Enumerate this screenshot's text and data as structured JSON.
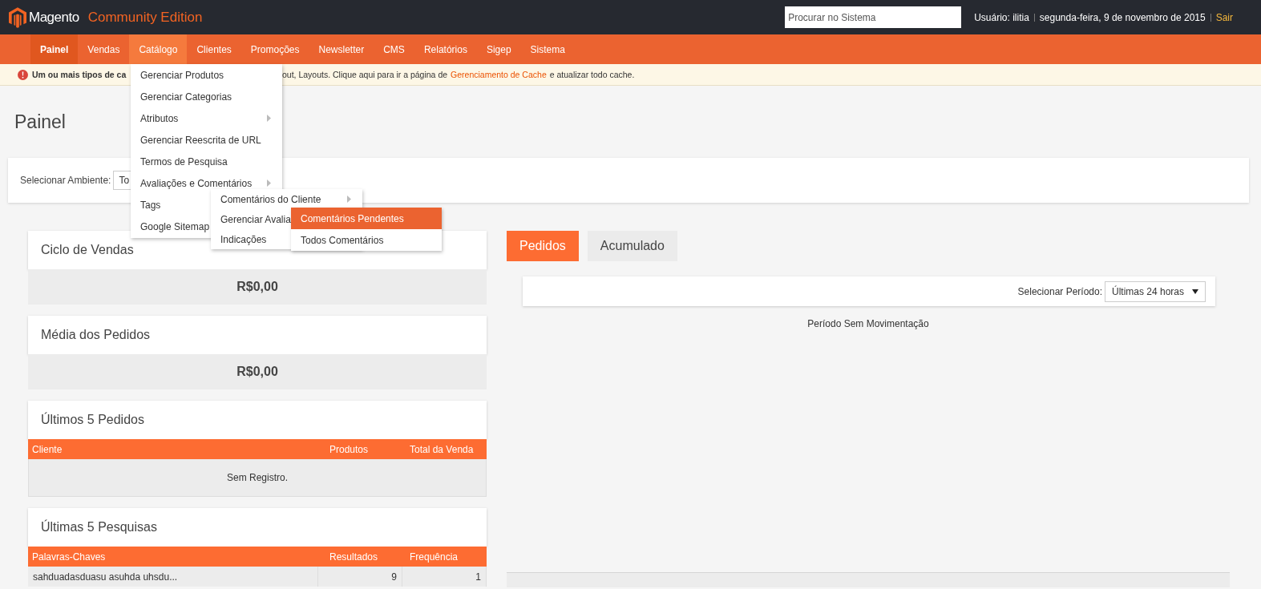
{
  "header": {
    "brand": "Magento",
    "edition": "Community Edition",
    "search": {
      "placeholder": "Procurar no Sistema"
    },
    "user": "Usuário: ilitia",
    "date": "segunda-feira, 9 de novembro de 2015",
    "logout": "Sair"
  },
  "nav": [
    {
      "label": "Painel",
      "current": true,
      "selected": false
    },
    {
      "label": "Vendas",
      "current": false,
      "selected": false
    },
    {
      "label": "Catálogo",
      "current": false,
      "selected": true
    },
    {
      "label": "Clientes",
      "current": false,
      "selected": false
    },
    {
      "label": "Promoções",
      "current": false,
      "selected": false
    },
    {
      "label": "Newsletter",
      "current": false,
      "selected": false
    },
    {
      "label": "CMS",
      "current": false,
      "selected": false
    },
    {
      "label": "Relatórios",
      "current": false,
      "selected": false
    },
    {
      "label": "Sigep",
      "current": false,
      "selected": false
    },
    {
      "label": "Sistema",
      "current": false,
      "selected": false
    }
  ],
  "notice": {
    "bold": "Um ou mais tipos de ca",
    "text": "out, Layouts. Clique aqui para ir a página de",
    "link": "Gerenciamento de Cache",
    "after": "e atualizar todo cache."
  },
  "catalog_menu": [
    {
      "label": "Gerenciar Produtos",
      "submenu": false
    },
    {
      "label": "Gerenciar Categorias",
      "submenu": false
    },
    {
      "label": "Atributos",
      "submenu": true
    },
    {
      "label": "Gerenciar Reescrita de URL",
      "submenu": false
    },
    {
      "label": "Termos de Pesquisa",
      "submenu": false
    },
    {
      "label": "Avaliações e Comentários",
      "submenu": true
    },
    {
      "label": "Tags"
    },
    {
      "label": "Google Sitemap"
    }
  ],
  "reviews_menu": [
    {
      "label": "Comentários do Cliente",
      "submenu": true
    },
    {
      "label": "Gerenciar Avalia"
    },
    {
      "label": "Indicações"
    }
  ],
  "customer_reviews_menu": [
    {
      "label": "Comentários Pendentes",
      "selected": true
    },
    {
      "label": "Todos Comentários",
      "selected": false
    }
  ],
  "page_title": "Painel",
  "store_switcher": {
    "label": "Selecionar Ambiente:",
    "value": "To"
  },
  "cards": [
    {
      "kind": "value",
      "title": "Ciclo de Vendas",
      "value": "R$0,00"
    },
    {
      "kind": "value",
      "title": "Média dos Pedidos",
      "value": "R$0,00"
    },
    {
      "kind": "table",
      "title": "Últimos 5 Pedidos",
      "columns": [
        "Cliente",
        "Produtos",
        "Total da Venda"
      ],
      "empty": "Sem Registro."
    },
    {
      "kind": "table",
      "title": "Últimas 5 Pesquisas",
      "columns": [
        "Palavras-Chaves",
        "Resultados",
        "Frequência"
      ],
      "rows": [
        [
          "sahduadasduasu asuhda uhsdu...",
          "9",
          "1"
        ]
      ]
    }
  ],
  "chart_tabs": [
    {
      "label": "Pedidos",
      "selected": true
    },
    {
      "label": "Acumulado",
      "selected": false
    }
  ],
  "period": {
    "label": "Selecionar Período:",
    "value": "Últimas 24 horas"
  },
  "chart_empty": "Período Sem Movimentação"
}
